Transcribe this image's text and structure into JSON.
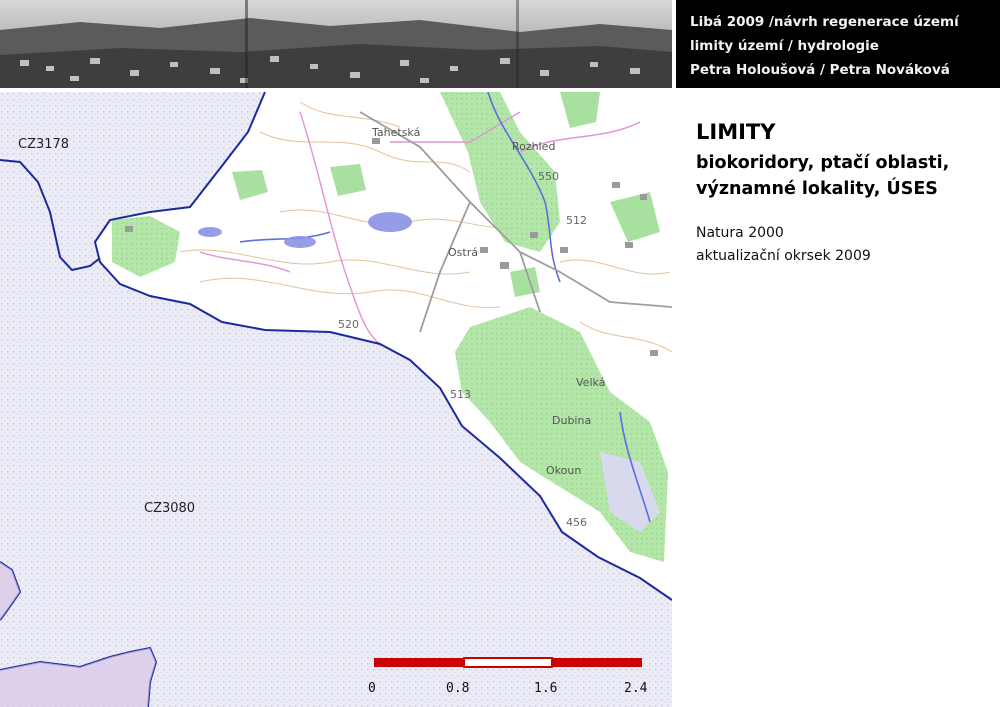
{
  "header": {
    "lines": [
      "Libá 2009 /návrh regenerace území",
      "limity území / hydrologie",
      "Petra Holoušová / Petra Nováková"
    ]
  },
  "panel": {
    "title": "LIMITY",
    "subtitle_lines": [
      "biokoridory, ptačí oblasti,",
      "významné lokality, ÚSES"
    ],
    "description_lines": [
      "Natura 2000",
      "aktualizační okrsek 2009"
    ]
  },
  "map": {
    "area_labels": [
      "CZ3178",
      "CZ3080"
    ],
    "place_labels": [
      "Tahetská",
      "Rozhled",
      "Ostrá",
      "Dubina",
      "Okoun",
      "Velká"
    ],
    "elevation_labels": [
      "520",
      "550",
      "512",
      "456",
      "513"
    ],
    "scale_bar": {
      "ticks": [
        "0",
        "0.8",
        "1.6",
        "2.4"
      ]
    },
    "colors": {
      "natura_area": "#e6e6f5",
      "natura_boundary": "#1a2a9a",
      "forest": "#a8e0a0",
      "forest_dark": "#6fcf7a",
      "contour": "#e0b890",
      "stream": "#5566dd",
      "roads": "#9a9a9a",
      "corridor": "#e080c8",
      "scale_red": "#cc0000"
    }
  }
}
